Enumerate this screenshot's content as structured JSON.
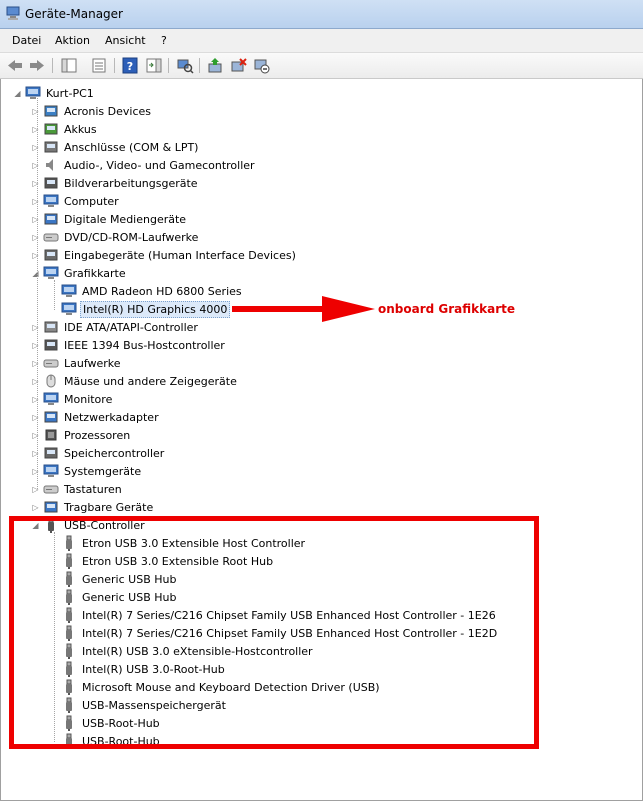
{
  "window": {
    "title": "Geräte-Manager"
  },
  "menu": [
    "Datei",
    "Aktion",
    "Ansicht",
    "?"
  ],
  "toolbar_icons": [
    "back-arrow-icon",
    "forward-arrow-icon",
    "show-hide-console-tree-icon",
    "properties-icon",
    "help-icon",
    "action-pane-icon",
    "scan-hardware-icon",
    "update-driver-icon",
    "uninstall-icon",
    "disable-device-icon"
  ],
  "tree": {
    "root": "Kurt-PC1",
    "categories": [
      {
        "label": "Acronis Devices",
        "icon": "acronis-icon"
      },
      {
        "label": "Akkus",
        "icon": "battery-icon"
      },
      {
        "label": "Anschlüsse (COM & LPT)",
        "icon": "port-icon"
      },
      {
        "label": "Audio-, Video- und Gamecontroller",
        "icon": "speaker-icon"
      },
      {
        "label": "Bildverarbeitungsgeräte",
        "icon": "camera-icon"
      },
      {
        "label": "Computer",
        "icon": "computer-icon"
      },
      {
        "label": "Digitale Mediengeräte",
        "icon": "media-icon"
      },
      {
        "label": "DVD/CD-ROM-Laufwerke",
        "icon": "dvd-icon"
      },
      {
        "label": "Eingabegeräte (Human Interface Devices)",
        "icon": "hid-icon"
      },
      {
        "label": "Grafikkarte",
        "icon": "display-adapter-icon",
        "expanded": true,
        "children": [
          "AMD Radeon HD 6800 Series",
          "Intel(R) HD Graphics 4000"
        ]
      },
      {
        "label": "IDE ATA/ATAPI-Controller",
        "icon": "ide-icon"
      },
      {
        "label": "IEEE 1394 Bus-Hostcontroller",
        "icon": "firewire-icon"
      },
      {
        "label": "Laufwerke",
        "icon": "disk-icon"
      },
      {
        "label": "Mäuse und andere Zeigegeräte",
        "icon": "mouse-icon"
      },
      {
        "label": "Monitore",
        "icon": "monitor-icon"
      },
      {
        "label": "Netzwerkadapter",
        "icon": "network-icon"
      },
      {
        "label": "Prozessoren",
        "icon": "processor-icon"
      },
      {
        "label": "Speichercontroller",
        "icon": "storage-icon"
      },
      {
        "label": "Systemgeräte",
        "icon": "system-icon"
      },
      {
        "label": "Tastaturen",
        "icon": "keyboard-icon"
      },
      {
        "label": "Tragbare Geräte",
        "icon": "portable-icon"
      },
      {
        "label": "USB-Controller",
        "icon": "usb-icon",
        "expanded": true,
        "children": [
          "Etron USB 3.0 Extensible Host Controller",
          "Etron USB 3.0 Extensible Root Hub",
          "Generic USB Hub",
          "Generic USB Hub",
          "Intel(R) 7 Series/C216 Chipset Family USB Enhanced Host Controller - 1E26",
          "Intel(R) 7 Series/C216 Chipset Family USB Enhanced Host Controller - 1E2D",
          "Intel(R) USB 3.0 eXtensible-Hostcontroller",
          "Intel(R) USB 3.0-Root-Hub",
          "Microsoft Mouse and Keyboard Detection Driver (USB)",
          "USB-Massenspeichergerät",
          "USB-Root-Hub",
          "USB-Root-Hub"
        ]
      }
    ],
    "selected": "Intel(R) HD Graphics 4000"
  },
  "annotation": {
    "text": "onboard Grafikkarte",
    "color": "#dd0000"
  },
  "highlight_color": "#ee0000"
}
